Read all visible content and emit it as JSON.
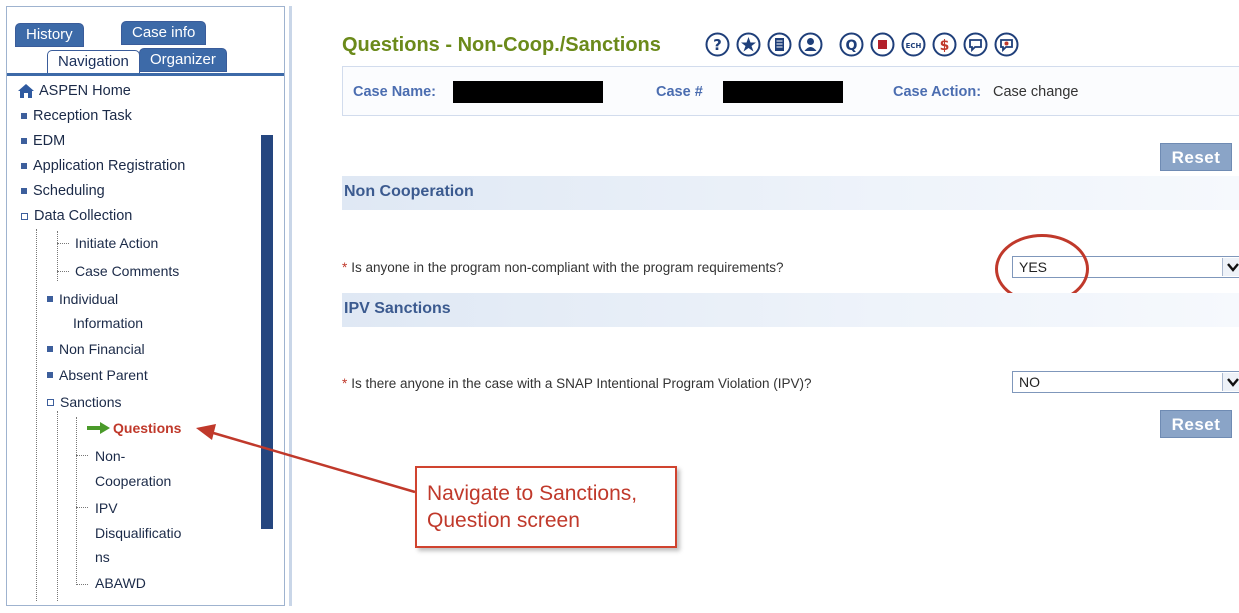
{
  "left_panel": {
    "tabs": {
      "history": "History",
      "case_info": "Case info",
      "navigation": "Navigation",
      "organizer": "Organizer"
    },
    "home": "ASPEN Home",
    "items": {
      "reception_task": "Reception Task",
      "edm": "EDM",
      "application_registration": "Application Registration",
      "scheduling": "Scheduling",
      "data_collection": "Data Collection",
      "initiate_action": "Initiate Action",
      "case_comments": "Case Comments",
      "individual_line1": "Individual",
      "individual_line2": "Information",
      "non_financial": "Non Financial",
      "absent_parent": "Absent Parent",
      "sanctions": "Sanctions",
      "questions": "Questions",
      "non_coop_line1": "Non-",
      "non_coop_line2": "Cooperation",
      "ipv_line1": "IPV",
      "ipv_line2": "Disqualificatio",
      "ipv_line3": "ns",
      "abawd": "ABAWD"
    }
  },
  "main": {
    "title": "Questions - Non-Coop./Sanctions",
    "case_bar": {
      "case_name_label": "Case Name:",
      "case_number_label": "Case #",
      "case_action_label": "Case Action:",
      "case_action_value": "Case change"
    },
    "reset_label": "Reset",
    "sections": {
      "non_cooperation": "Non Cooperation",
      "ipv_sanctions": "IPV Sanctions"
    },
    "questions": {
      "q1_text": "Is anyone in the program non-compliant with the program requirements?",
      "q1_value": "YES",
      "q2_text": "Is there anyone in the case with a SNAP Intentional Program Violation (IPV)?",
      "q2_value": "NO",
      "required_mark": "*"
    }
  },
  "annotation": {
    "line1": "Navigate to Sanctions,",
    "line2": "Question screen"
  },
  "icons": [
    "help-icon",
    "star-icon",
    "document-icon",
    "person-icon",
    "q-icon",
    "stop-icon",
    "ech-icon",
    "dollar-icon",
    "chat-icon",
    "chat-heart-icon"
  ],
  "colors": {
    "title_green": "#6b8a1a",
    "nav_blue": "#3d6aa8",
    "annotation_red": "#c0392b",
    "section_text": "#3b5a8f"
  }
}
